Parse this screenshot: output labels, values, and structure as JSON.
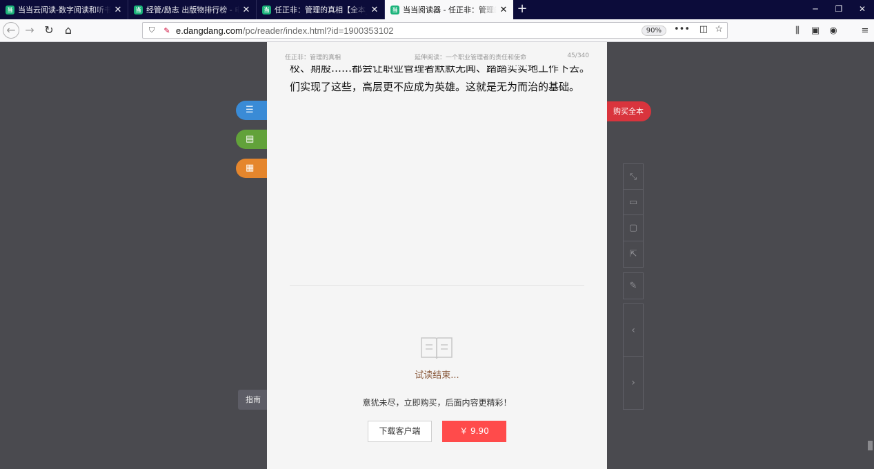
{
  "tabs": [
    {
      "title": "当当云阅读-数字阅读和听书平台",
      "favicon": "当",
      "active": false
    },
    {
      "title": "经管/励志 出版物排行榜 - 电子书",
      "favicon": "当",
      "active": false
    },
    {
      "title": "任正非：管理的真相【全本_书评",
      "favicon": "当",
      "active": false
    },
    {
      "title": "当当阅读器 - 任正非：管理的真相",
      "favicon": "当",
      "active": true
    }
  ],
  "url": {
    "domain": "e.dangdang.com",
    "path": "/pc/reader/index.html?id=1900353102",
    "zoom": "90%"
  },
  "reader": {
    "running_head_left": "任正非：管理的真相",
    "running_head_center": "延伸阅读：一个职业管理者的责任和使命",
    "running_head_right": "45/340",
    "body_line_1": "校、期股……都会让职业管理者默默无闻、踏踏实实地工作下去。我",
    "body_line_2": "们实现了这些，高层更不应成为英雄。这就是无为而治的基础。",
    "trial_end": "试读结束...",
    "promo": "意犹未尽，立即购买，后面内容更精彩！",
    "download_label": "下载客户端",
    "price_label": "￥ 9.90"
  },
  "side": {
    "guide_label": "指南",
    "buy_all_label": "购买全本"
  },
  "colors": {
    "buy_red": "#ff4b4b",
    "toc_blue": "#3a8bd6",
    "note_green": "#62a23a",
    "qr_orange": "#e5862d",
    "buyall_red": "#d9343d"
  }
}
